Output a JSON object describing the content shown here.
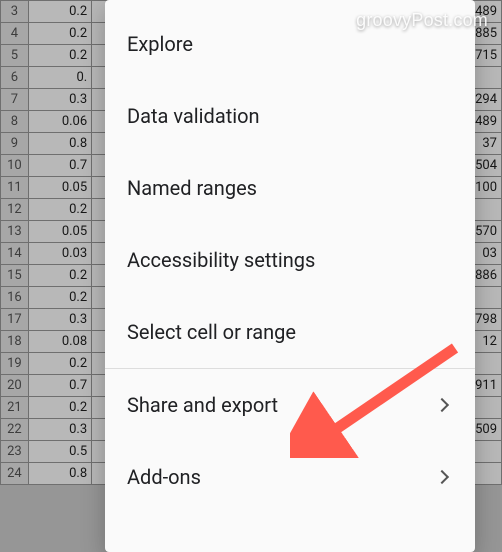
{
  "watermark": "groovyPost.com",
  "menu": {
    "items": [
      {
        "label": "Explore",
        "has_chevron": false
      },
      {
        "label": "Data validation",
        "has_chevron": false
      },
      {
        "label": "Named ranges",
        "has_chevron": false
      },
      {
        "label": "Accessibility settings",
        "has_chevron": false
      },
      {
        "label": "Select cell or range",
        "has_chevron": false
      },
      {
        "label": "Share and export",
        "has_chevron": true
      },
      {
        "label": "Add-ons",
        "has_chevron": true
      }
    ]
  },
  "spreadsheet": {
    "rows": [
      {
        "num": "3",
        "b": "0.2",
        "d": "489"
      },
      {
        "num": "4",
        "b": "0.2",
        "d": "885"
      },
      {
        "num": "5",
        "b": "0.2",
        "d": "715"
      },
      {
        "num": "6",
        "b": "0.",
        "d": ""
      },
      {
        "num": "7",
        "b": "0.3",
        "d": "294"
      },
      {
        "num": "8",
        "b": "0.06",
        "d": "489"
      },
      {
        "num": "9",
        "b": "0.8",
        "d": "37"
      },
      {
        "num": "10",
        "b": "0.7",
        "d": "504"
      },
      {
        "num": "11",
        "b": "0.05",
        "d": "100"
      },
      {
        "num": "12",
        "b": "0.2",
        "d": ""
      },
      {
        "num": "13",
        "b": "0.05",
        "d": "570"
      },
      {
        "num": "14",
        "b": "0.03",
        "d": "03"
      },
      {
        "num": "15",
        "b": "0.2",
        "d": "886"
      },
      {
        "num": "16",
        "b": "0.2",
        "d": ""
      },
      {
        "num": "17",
        "b": "0.3",
        "d": "798"
      },
      {
        "num": "18",
        "b": "0.08",
        "d": "12"
      },
      {
        "num": "19",
        "b": "0.2",
        "d": ""
      },
      {
        "num": "20",
        "b": "0.7",
        "d": "911"
      },
      {
        "num": "21",
        "b": "0.2",
        "d": ""
      },
      {
        "num": "22",
        "b": "0.3",
        "d": "509"
      },
      {
        "num": "23",
        "b": "0.5",
        "d": ""
      },
      {
        "num": "24",
        "b": "0.8",
        "d": ""
      }
    ]
  },
  "arrow_color": "#ff5a4d"
}
